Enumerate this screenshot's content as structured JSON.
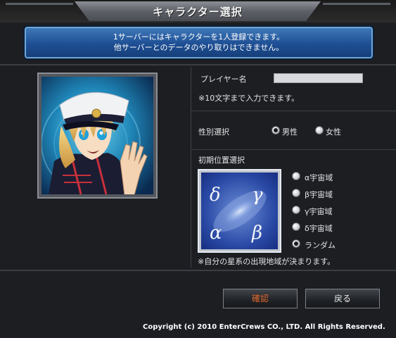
{
  "window": {
    "title": "キャラクター選択"
  },
  "notice": {
    "line1": "1サーバーにはキャラクターを1人登録できます。",
    "line2": "他サーバーとのデータのやり取りはできません。"
  },
  "player_name": {
    "label": "プレイヤー名",
    "value": "",
    "hint": "※10文字まで入力できます。"
  },
  "gender": {
    "label": "性別選択",
    "options": [
      {
        "label": "男性",
        "selected": true
      },
      {
        "label": "女性",
        "selected": false
      }
    ]
  },
  "start_position": {
    "label": "初期位置選択",
    "galaxy_letters": [
      "δ",
      "γ",
      "α",
      "β"
    ],
    "options": [
      {
        "label": "α宇宙域",
        "selected": false
      },
      {
        "label": "β宇宙域",
        "selected": false
      },
      {
        "label": "γ宇宙域",
        "selected": false
      },
      {
        "label": "δ宇宙域",
        "selected": false
      },
      {
        "label": "ランダム",
        "selected": true
      }
    ],
    "note": "※自分の星系の出現地域が決まります。"
  },
  "buttons": {
    "confirm": "確認",
    "back": "戻る"
  },
  "copyright": "Copyright (c) 2010 EnterCrews CO., LTD. All Rights Reserved.",
  "colors": {
    "notice_bg": "#1e4f94",
    "confirm_text": "#e0682a",
    "background": "#1c1e22"
  }
}
